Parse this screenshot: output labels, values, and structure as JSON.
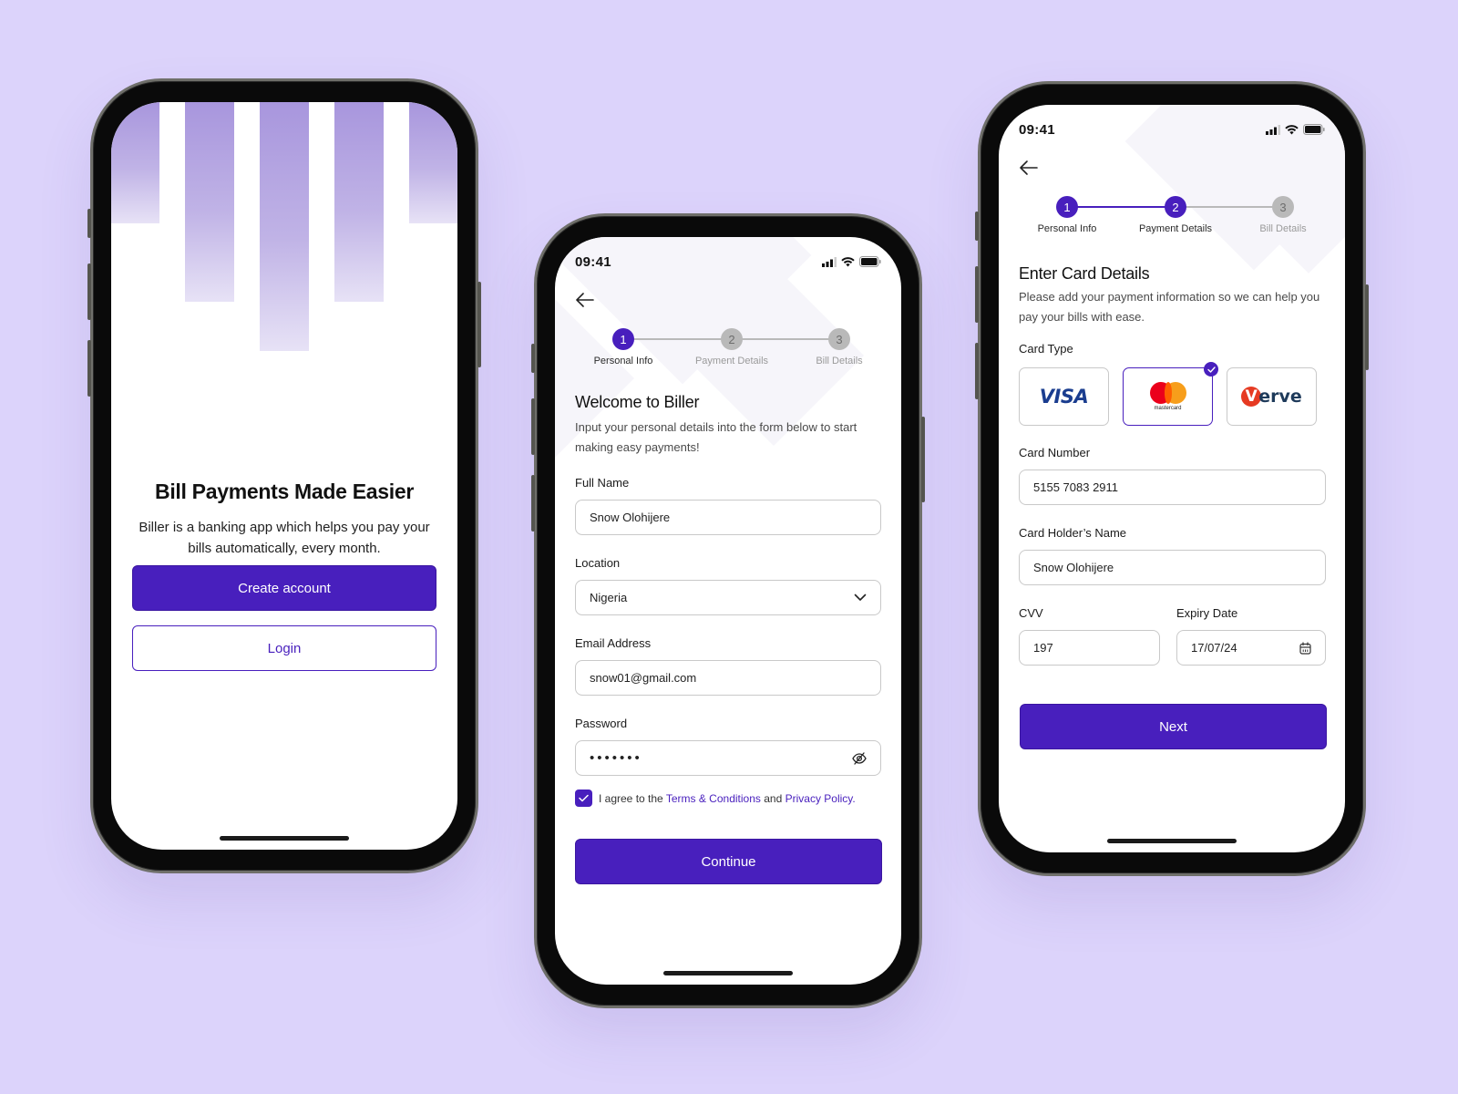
{
  "colors": {
    "primary": "#481fbd",
    "background": "#dcd3fb",
    "inactive_step": "#b9b9b9"
  },
  "onboarding": {
    "title": "Bill Payments Made Easier",
    "description": "Biller is a banking app which helps you pay your bills automatically, every month.",
    "create_account_label": "Create account",
    "login_label": "Login"
  },
  "status_bar": {
    "time": "09:41",
    "icons": [
      "signal-icon",
      "wifi-icon",
      "battery-icon"
    ]
  },
  "steps": [
    {
      "number": "1",
      "label": "Personal Info"
    },
    {
      "number": "2",
      "label": "Payment Details"
    },
    {
      "number": "3",
      "label": "Bill Details"
    }
  ],
  "personal_info": {
    "current_step": 1,
    "title": "Welcome to Biller",
    "subtitle": "Input your personal details into the form below to start making easy payments!",
    "full_name": {
      "label": "Full Name",
      "value": "Snow Olohijere"
    },
    "location": {
      "label": "Location",
      "value": "Nigeria"
    },
    "email": {
      "label": "Email Address",
      "value": "snow01@gmail.com"
    },
    "password": {
      "label": "Password",
      "value": "•••••••"
    },
    "agree": {
      "checked": true,
      "prefix": "I agree to the",
      "terms": "Terms & Conditions",
      "and": "and",
      "privacy": "Privacy Policy."
    },
    "continue_label": "Continue"
  },
  "payment_details": {
    "current_step": 2,
    "title": "Enter Card Details",
    "subtitle": "Please add your payment information so we can help you pay your bills with ease.",
    "card_type_label": "Card Type",
    "card_types": [
      {
        "name": "VISA",
        "selected": false
      },
      {
        "name": "mastercard",
        "selected": true
      },
      {
        "name": "Verve",
        "selected": false
      }
    ],
    "verve_rest": "erve",
    "verve_v": "V",
    "card_number": {
      "label": "Card Number",
      "value": "5155 7083 2911"
    },
    "card_holder": {
      "label": "Card Holder’s Name",
      "value": "Snow Olohijere"
    },
    "cvv": {
      "label": "CVV",
      "value": "197"
    },
    "expiry": {
      "label": "Expiry Date",
      "value": "17/07/24"
    },
    "next_label": "Next"
  }
}
